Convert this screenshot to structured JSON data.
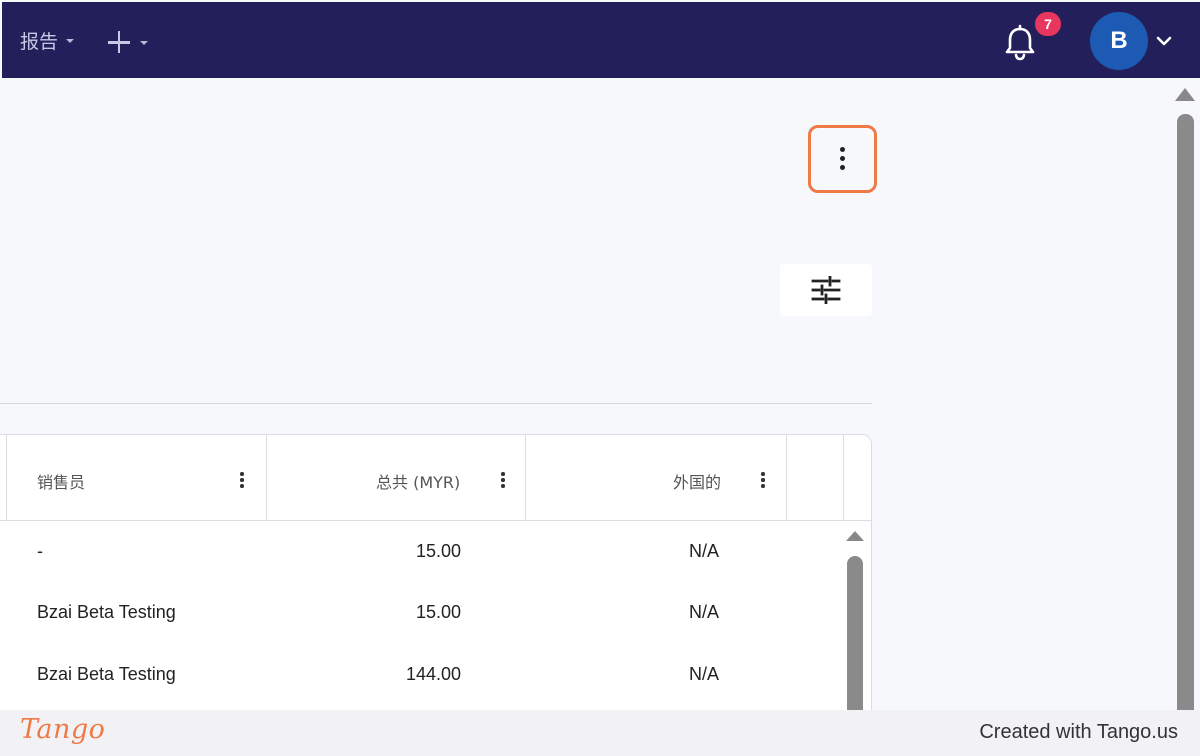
{
  "topbar": {
    "reports_label": "报告",
    "notifications_count": "7",
    "avatar_initial": "B",
    "background_color": "#221f5a"
  },
  "table": {
    "columns": [
      {
        "label": "销售员"
      },
      {
        "label": "总共 (MYR)"
      },
      {
        "label": "外国的"
      }
    ],
    "rows": [
      {
        "salesperson": "-",
        "total": "15.00",
        "foreign": "N/A"
      },
      {
        "salesperson": "Bzai Beta Testing",
        "total": "15.00",
        "foreign": "N/A"
      },
      {
        "salesperson": "Bzai Beta Testing",
        "total": "144.00",
        "foreign": "N/A"
      }
    ]
  },
  "footer": {
    "logo_text": "Tango",
    "credit_text": "Created with Tango.us"
  },
  "colors": {
    "highlight": "#f07a45",
    "badge": "#e8375e",
    "avatar": "#1c5ab4"
  }
}
